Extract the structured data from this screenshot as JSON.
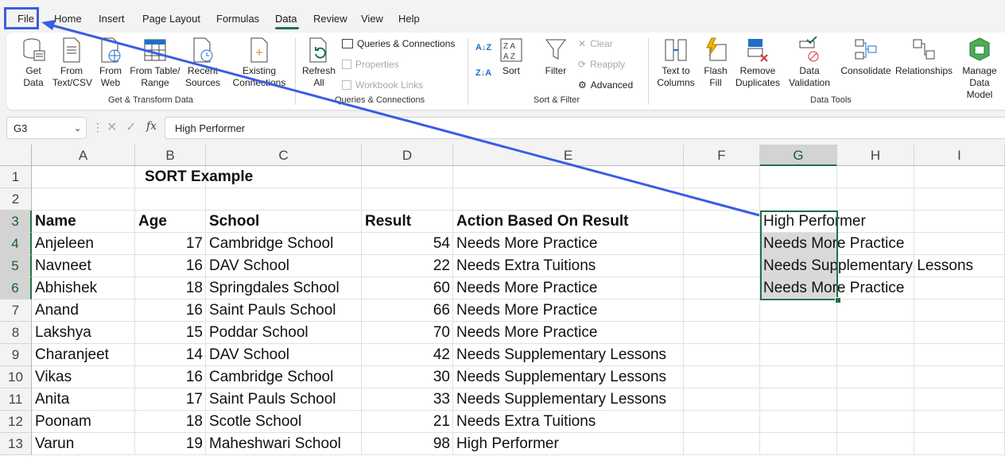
{
  "menu": {
    "tabs": [
      "File",
      "Home",
      "Insert",
      "Page Layout",
      "Formulas",
      "Data",
      "Review",
      "View",
      "Help"
    ],
    "active": "Data"
  },
  "ribbon": {
    "get_data": "Get\nData",
    "from_text": "From\nText/CSV",
    "from_web": "From\nWeb",
    "from_table": "From Table/\nRange",
    "recent_sources": "Recent\nSources",
    "existing_connections": "Existing\nConnections",
    "refresh_all": "Refresh\nAll",
    "queries_connections": "Queries & Connections",
    "properties": "Properties",
    "workbook_links": "Workbook Links",
    "sort": "Sort",
    "filter": "Filter",
    "clear": "Clear",
    "reapply": "Reapply",
    "advanced": "Advanced",
    "text_to_columns": "Text to\nColumns",
    "flash_fill": "Flash\nFill",
    "remove_duplicates": "Remove\nDuplicates",
    "data_validation": "Data\nValidation",
    "consolidate": "Consolidate",
    "relationships": "Relationships",
    "manage_data_model": "Manage\nData Model",
    "groups": {
      "get_transform": "Get & Transform Data",
      "queries": "Queries & Connections",
      "sort_filter": "Sort & Filter",
      "data_tools": "Data Tools"
    }
  },
  "formula_bar": {
    "name_box": "G3",
    "fx": "fx",
    "formula": "High Performer"
  },
  "columns": [
    "A",
    "B",
    "C",
    "D",
    "E",
    "F",
    "G",
    "H",
    "I"
  ],
  "rows": [
    "1",
    "2",
    "3",
    "4",
    "5",
    "6",
    "7",
    "8",
    "9",
    "10",
    "11",
    "12",
    "13"
  ],
  "sheet": {
    "title": "SORT Example",
    "headers": [
      "Name",
      "Age",
      "School",
      "Result",
      "Action Based On Result"
    ],
    "data": [
      [
        "Anjeleen",
        "17",
        "Cambridge School",
        "54",
        "Needs More Practice"
      ],
      [
        "Navneet",
        "16",
        "DAV School",
        "22",
        "Needs Extra Tuitions"
      ],
      [
        "Abhishek",
        "18",
        "Springdales School",
        "60",
        "Needs More Practice"
      ],
      [
        "Anand",
        "16",
        "Saint Pauls School",
        "66",
        "Needs More Practice"
      ],
      [
        "Lakshya",
        "15",
        "Poddar School",
        "70",
        "Needs More Practice"
      ],
      [
        "Charanjeet",
        "14",
        "DAV School",
        "42",
        "Needs Supplementary Lessons"
      ],
      [
        "Vikas",
        "16",
        "Cambridge School",
        "30",
        "Needs Supplementary Lessons"
      ],
      [
        "Anita",
        "17",
        "Saint Pauls School",
        "33",
        "Needs Supplementary Lessons"
      ],
      [
        "Poonam",
        "18",
        "Scotle School",
        "21",
        "Needs Extra Tuitions"
      ],
      [
        "Varun",
        "19",
        "Maheshwari School",
        "98",
        "High Performer"
      ]
    ],
    "g_column": [
      "High Performer",
      "Needs More Practice",
      "Needs Supplementary Lessons",
      "Needs More Practice"
    ]
  },
  "colors": {
    "accent": "#217346",
    "annotation": "#3a5de5"
  }
}
